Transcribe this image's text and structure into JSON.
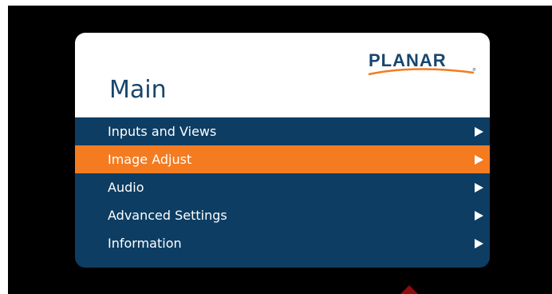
{
  "brand": {
    "logo_text": "PLANAR",
    "logo_colors": {
      "text": "#17466f",
      "swoosh": "#f47b20"
    }
  },
  "osd": {
    "title": "Main",
    "colors": {
      "panel": "#0d3d63",
      "selected": "#f47b20",
      "header": "#ffffff"
    },
    "menu": [
      {
        "label": "Inputs and Views",
        "selected": false
      },
      {
        "label": "Image Adjust",
        "selected": true
      },
      {
        "label": "Audio",
        "selected": false
      },
      {
        "label": "Advanced Settings",
        "selected": false
      },
      {
        "label": "Information",
        "selected": false
      }
    ]
  }
}
